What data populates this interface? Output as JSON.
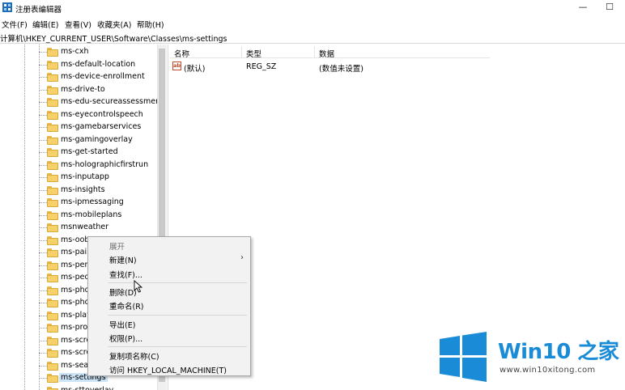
{
  "window": {
    "title": "注册表编辑器",
    "minimize_glyph": "—",
    "maximize_glyph": "☐"
  },
  "menu": {
    "items": [
      "文件(F)",
      "编辑(E)",
      "查看(V)",
      "收藏夹(A)",
      "帮助(H)"
    ]
  },
  "address": {
    "path": "计算机\\HKEY_CURRENT_USER\\Software\\Classes\\ms-settings"
  },
  "tree": {
    "items": [
      {
        "label": "ms-cxh"
      },
      {
        "label": "ms-default-location"
      },
      {
        "label": "ms-device-enrollment"
      },
      {
        "label": "ms-drive-to"
      },
      {
        "label": "ms-edu-secureassessment"
      },
      {
        "label": "ms-eyecontrolspeech"
      },
      {
        "label": "ms-gamebarservices"
      },
      {
        "label": "ms-gamingoverlay"
      },
      {
        "label": "ms-get-started"
      },
      {
        "label": "ms-holographicfirstrun"
      },
      {
        "label": "ms-inputapp"
      },
      {
        "label": "ms-insights"
      },
      {
        "label": "ms-ipmessaging"
      },
      {
        "label": "ms-mobileplans"
      },
      {
        "label": "msnweather"
      },
      {
        "label": "ms-oob"
      },
      {
        "label": "ms-pair"
      },
      {
        "label": "ms-pen"
      },
      {
        "label": "ms-peo"
      },
      {
        "label": "ms-pho"
      },
      {
        "label": "ms-pho"
      },
      {
        "label": "ms-play"
      },
      {
        "label": "ms-pro"
      },
      {
        "label": "ms-scre"
      },
      {
        "label": "ms-scre"
      },
      {
        "label": "ms-sear"
      },
      {
        "label": "ms-settings",
        "selected": true
      },
      {
        "label": "ms-sttoverlay"
      }
    ]
  },
  "list": {
    "columns": [
      "名称",
      "类型",
      "数据"
    ],
    "rows": [
      {
        "name": "(默认)",
        "type": "REG_SZ",
        "data": "(数值未设置)",
        "icon": "ab-string-icon"
      }
    ]
  },
  "context_menu": {
    "items": [
      {
        "label": "展开",
        "disabled": true
      },
      {
        "label": "新建(N)",
        "submenu": true
      },
      {
        "label": "查找(F)..."
      },
      {
        "separator": true
      },
      {
        "label": "删除(D)"
      },
      {
        "label": "重命名(R)"
      },
      {
        "separator": true
      },
      {
        "label": "导出(E)"
      },
      {
        "label": "权限(P)..."
      },
      {
        "separator": true
      },
      {
        "label": "复制项名称(C)"
      },
      {
        "label": "访问 HKEY_LOCAL_MACHINE(T)"
      }
    ],
    "submenu_arrow": "›"
  },
  "watermark": {
    "title_latin": "Win10",
    "title_cjk": "之家",
    "url": "www.win10xitong.com"
  },
  "colors": {
    "accent": "#1a8bd6",
    "folder": "#f6d06a",
    "selection": "#cce4f7"
  }
}
